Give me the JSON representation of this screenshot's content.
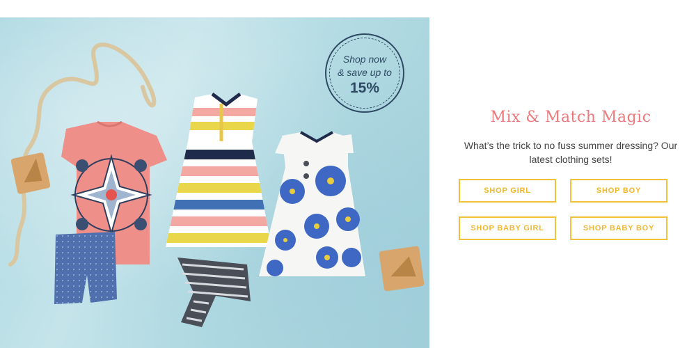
{
  "promo": {
    "line1": "Shop now",
    "line2": "& save up to",
    "line3": "15%"
  },
  "headline": "Mix & Match Magic",
  "description": "What’s the trick to no fuss summer dressing? Our latest clothing sets!",
  "buttons": {
    "shop_girl": "SHOP GIRL",
    "shop_boy": "SHOP BOY",
    "shop_baby_girl": "SHOP BABY GIRL",
    "shop_baby_boy": "SHOP BABY BOY"
  },
  "colors": {
    "headline": "#ec7a7c",
    "button_border": "#f2c13b",
    "button_text": "#f0b72c",
    "badge": "#2e4a63",
    "hero_background": "#b3dbe3"
  }
}
